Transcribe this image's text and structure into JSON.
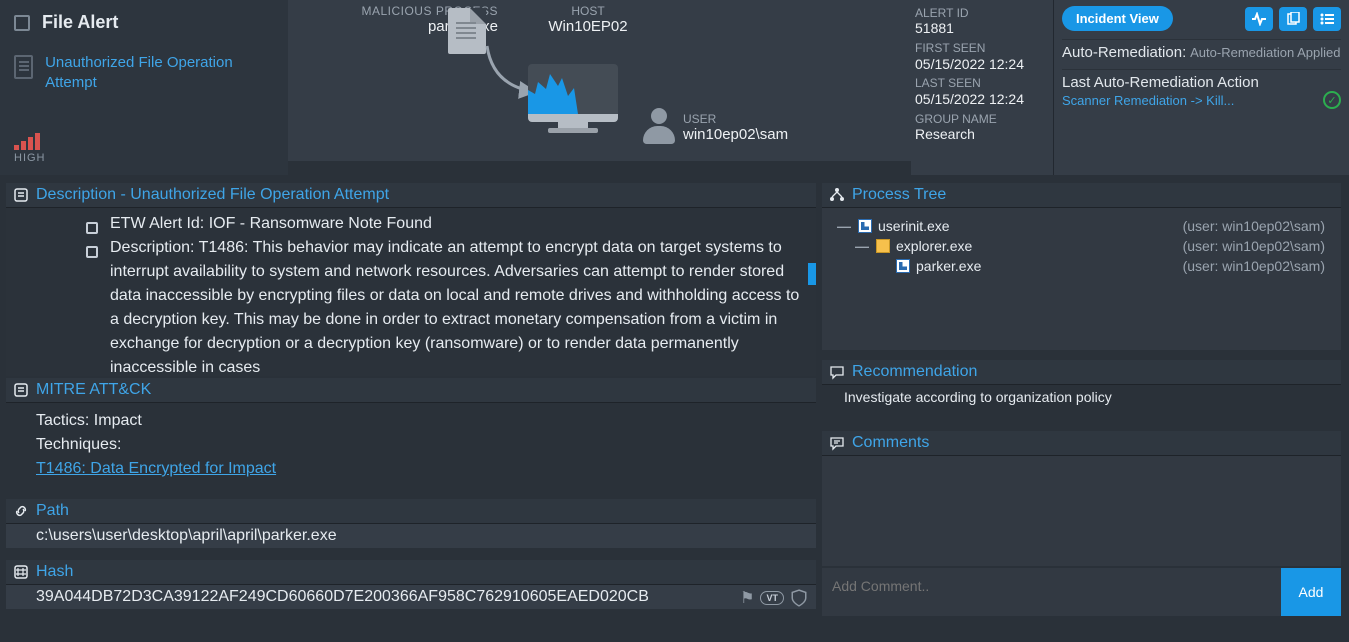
{
  "left": {
    "title": "File Alert",
    "alert_name": "Unauthorized File Operation Attempt",
    "severity": "HIGH"
  },
  "center": {
    "mal_label": "MALICIOUS PROCESS",
    "mal_value": "parker.exe",
    "host_label": "HOST",
    "host_value": "Win10EP02",
    "user_label": "USER",
    "user_value": "win10ep02\\sam"
  },
  "meta": {
    "alert_id_label": "ALERT ID",
    "alert_id": "51881",
    "first_seen_label": "FIRST SEEN",
    "first_seen": "05/15/2022 12:24",
    "last_seen_label": "LAST SEEN",
    "last_seen": "05/15/2022 12:24",
    "group_label": "GROUP NAME",
    "group": "Research"
  },
  "right": {
    "incident_btn": "Incident View",
    "auto_label": "Auto-Remediation:",
    "auto_value": "Auto-Remediation Applied",
    "last_action_label": "Last Auto-Remediation Action",
    "last_action_link": "Scanner Remediation -> Kill..."
  },
  "desc": {
    "heading": "Description - Unauthorized File Operation Attempt",
    "line1": "ETW Alert Id: IOF - Ransomware Note Found",
    "line2": "Description: T1486: This behavior may indicate an attempt to encrypt data on target systems to interrupt availability to system and network resources. Adversaries can attempt to render stored data inaccessible by encrypting files or data on local and remote drives and withholding access to a decryption key. This may be done in order to extract monetary compensation from a victim in exchange for decryption or a decryption key (ransomware) or to render data permanently inaccessible in cases"
  },
  "mitre": {
    "heading": "MITRE ATT&CK",
    "tactics": "Tactics: Impact",
    "techniques_label": "Techniques:",
    "technique_link": "T1486: Data Encrypted for Impact"
  },
  "path": {
    "heading": "Path",
    "value": "c:\\users\\user\\desktop\\april\\april\\parker.exe"
  },
  "hash": {
    "heading": "Hash",
    "value": "39A044DB72D3CA39122AF249CD60660D7E200366AF958C762910605EAED020CB"
  },
  "ptree": {
    "heading": "Process Tree",
    "rows": [
      {
        "name": "userinit.exe",
        "user": "(user: win10ep02\\sam)",
        "icon": "win",
        "indent": 0,
        "toggle": true
      },
      {
        "name": "explorer.exe",
        "user": "(user: win10ep02\\sam)",
        "icon": "folder",
        "indent": 1,
        "toggle": true
      },
      {
        "name": "parker.exe",
        "user": "(user: win10ep02\\sam)",
        "icon": "win",
        "indent": 2,
        "toggle": false
      }
    ]
  },
  "reco": {
    "heading": "Recommendation",
    "text": "Investigate according to organization policy"
  },
  "comments": {
    "heading": "Comments",
    "placeholder": "Add Comment..",
    "add_btn": "Add"
  }
}
